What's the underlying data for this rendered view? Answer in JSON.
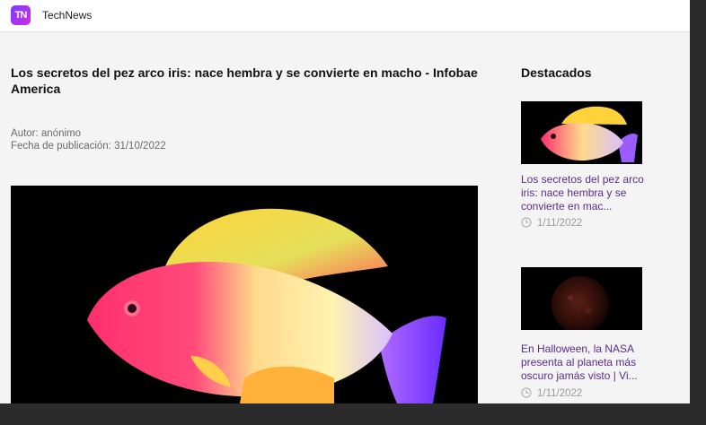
{
  "app": {
    "brand": "TechNews",
    "logo_text": "TN"
  },
  "article": {
    "title": "Los secretos del pez arco iris: nace hembra y se convierte en macho - Infobae America",
    "author": "Autor: anónimo",
    "date": "Fecha de publicación: 31/10/2022",
    "image_subject": "rainbow-fish"
  },
  "sidebar": {
    "heading": "Destacados",
    "items": [
      {
        "title": "Los secretos del pez arco iris: nace hembra y se convierte en mac...",
        "date": "1/11/2022",
        "image_subject": "rainbow-fish"
      },
      {
        "title": "En Halloween, la NASA presenta al planeta más oscuro jamás visto | Vi...",
        "date": "1/11/2022",
        "image_subject": "dark-planet"
      }
    ]
  },
  "colors": {
    "link": "#5b2a8c",
    "logo_start": "#7a3cff",
    "logo_end": "#d12be0"
  }
}
